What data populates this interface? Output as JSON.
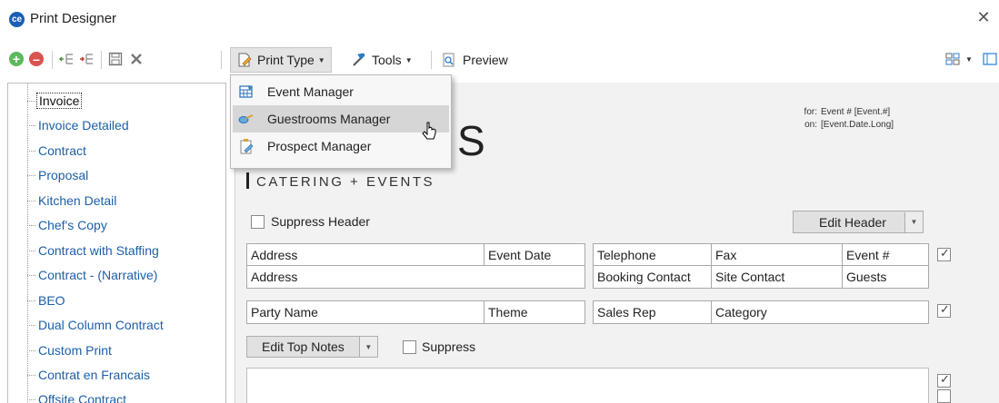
{
  "window": {
    "title": "Print Designer",
    "close": "✕"
  },
  "toolbar": {
    "print_type": "Print Type",
    "tools": "Tools",
    "preview": "Preview"
  },
  "print_type_menu": {
    "items": [
      {
        "label": "Event Manager",
        "icon": "calendar-grid-icon"
      },
      {
        "label": "Guestrooms Manager",
        "icon": "key-card-icon"
      },
      {
        "label": "Prospect Manager",
        "icon": "clipboard-pencil-icon"
      }
    ]
  },
  "tree": {
    "items": [
      "Invoice",
      "Invoice Detailed",
      "Contract",
      "Proposal",
      "Kitchen Detail",
      "Chef's Copy",
      "Contract with Staffing",
      "Contract - (Narrative)",
      "BEO",
      "Dual Column Contract",
      "Custom Print",
      "Contrat en Francais",
      "Offsite Contract"
    ],
    "selected_index": 0
  },
  "header": {
    "for_label": "for:",
    "for_value": "Event #  [Event.#]",
    "on_label": "on:",
    "on_value": "[Event.Date.Long]",
    "logo_letter": "S",
    "logo_tagline": "CATERING + EVENTS",
    "suppress_header": "Suppress Header",
    "edit_header": "Edit Header"
  },
  "fields": {
    "row1": [
      "Address",
      "Event Date",
      "Telephone",
      "Fax",
      "Event #"
    ],
    "row2": [
      "Address",
      "Booking Contact",
      "Site Contact",
      "Guests"
    ],
    "row3": [
      "Party Name",
      "Theme",
      "Sales Rep",
      "Category"
    ]
  },
  "top_notes": {
    "edit_label": "Edit Top Notes",
    "suppress_label": "Suppress"
  }
}
